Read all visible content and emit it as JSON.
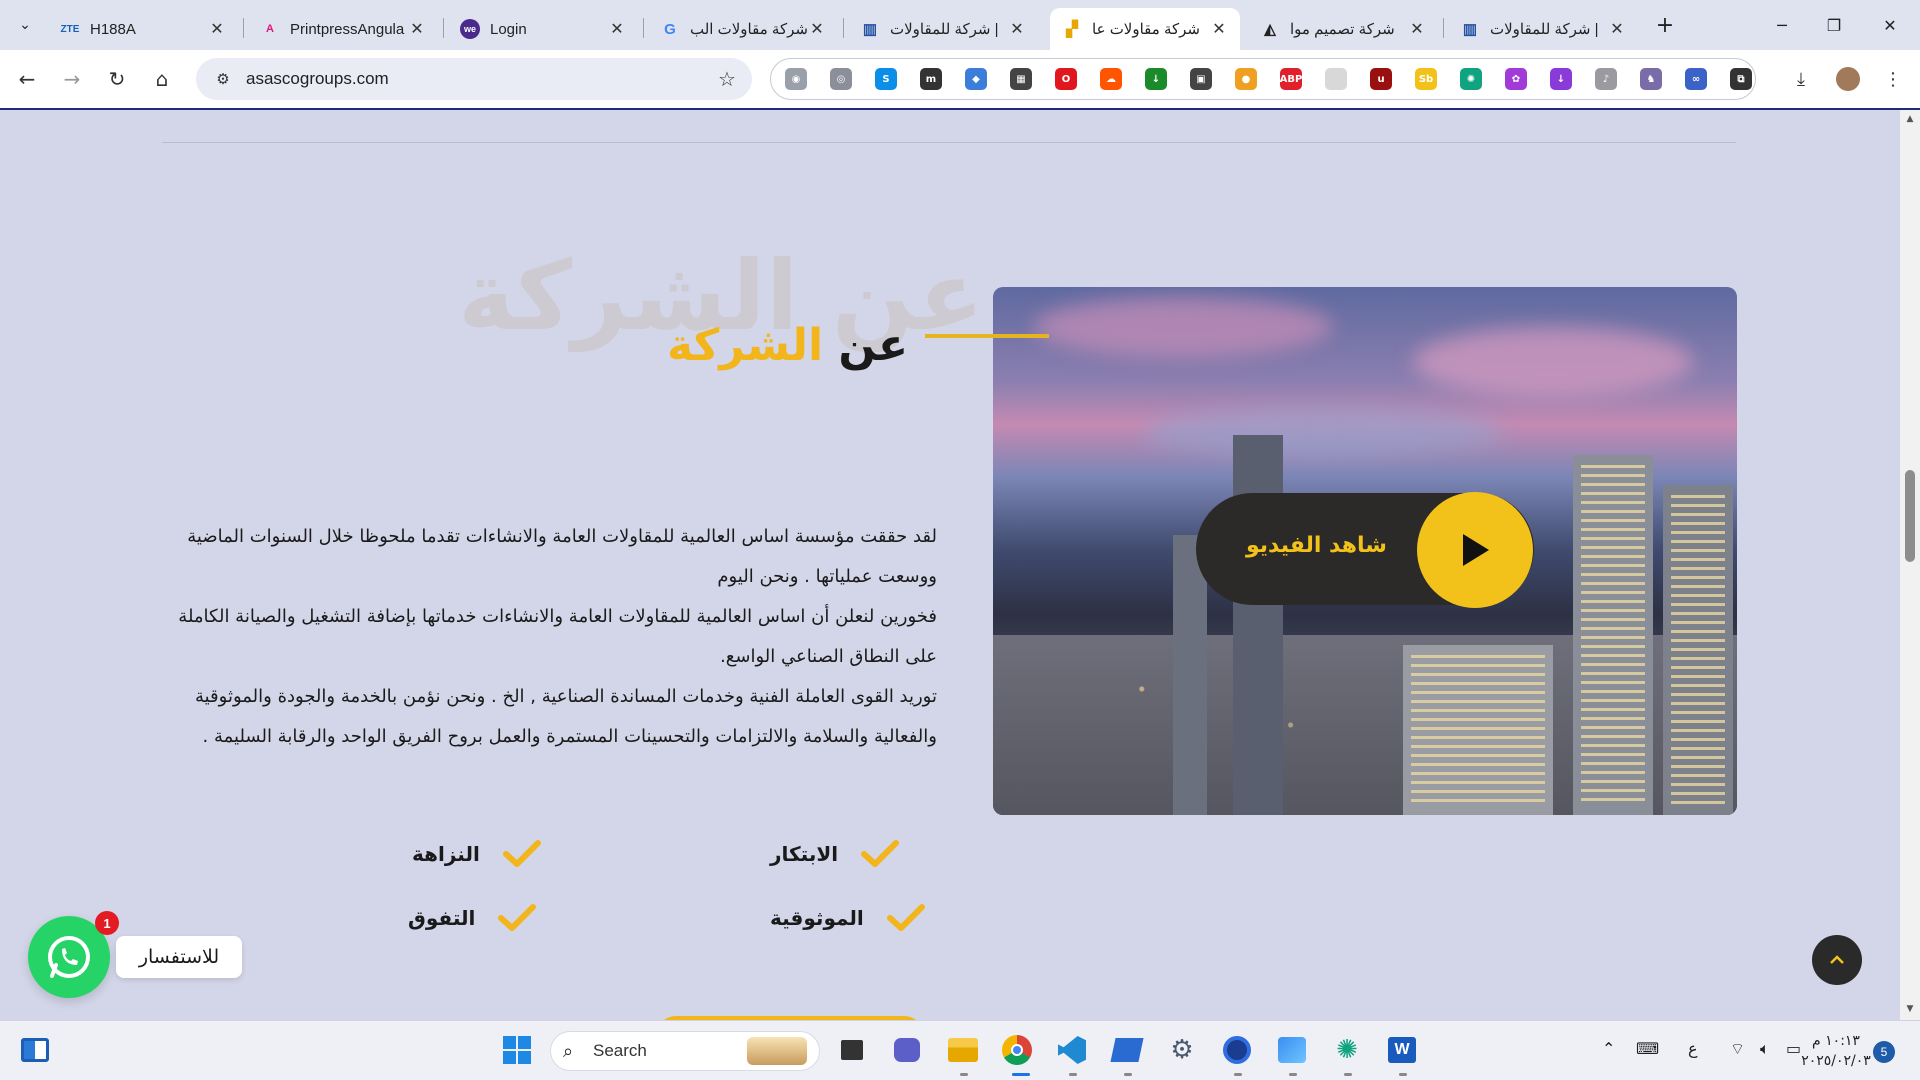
{
  "browser": {
    "tabs": [
      {
        "favicon": "ZTE",
        "title": "H188A",
        "fav_color": "#1762b5",
        "fav_text_color": "#1762b5"
      },
      {
        "favicon": "A",
        "title": "PrintpressAngula",
        "fav_color": "#dd1b7a",
        "fav_text_color": "#dd1b7a"
      },
      {
        "favicon": "we",
        "title": "Login",
        "fav_color": "#4b2a8c",
        "fav_text_color": "#ffffff"
      },
      {
        "favicon": "G",
        "title": "شركة مقاولات الب",
        "fav_color": "#4285f4",
        "fav_text_color": "#4285f4"
      },
      {
        "favicon": "▥",
        "title": "شركة للمقاولات |",
        "fav_color": "#1f4fa0",
        "fav_text_color": "#1f4fa0"
      },
      {
        "favicon": "▞",
        "title": "شركة مقاولات عا",
        "fav_color": "#e6a800",
        "fav_text_color": "#e6a800"
      },
      {
        "favicon": "◭",
        "title": "شركة تصميم موا",
        "fav_color": "#222222",
        "fav_text_color": "#222222"
      },
      {
        "favicon": "▥",
        "title": "شركة للمقاولات |",
        "fav_color": "#1f4fa0",
        "fav_text_color": "#1f4fa0"
      }
    ],
    "active_tab_index": 5,
    "url": "asascogroups.com",
    "extensions": [
      {
        "name": "eye-extension-icon",
        "color": "#9aa0aa",
        "glyph": "◉"
      },
      {
        "name": "target-extension-icon",
        "color": "#8a8f99",
        "glyph": "◎"
      },
      {
        "name": "shazam-extension-icon",
        "color": "#0a8ee8",
        "glyph": "S"
      },
      {
        "name": "m-extension-icon",
        "color": "#333333",
        "glyph": "m"
      },
      {
        "name": "diamond-extension-icon",
        "color": "#3b7dd8",
        "glyph": "◆"
      },
      {
        "name": "qr-extension-icon",
        "color": "#444444",
        "glyph": "▦"
      },
      {
        "name": "opera-extension-icon",
        "color": "#e0171d",
        "glyph": "O"
      },
      {
        "name": "soundcloud-extension-icon",
        "color": "#ff5500",
        "glyph": "☁"
      },
      {
        "name": "download-extension-icon",
        "color": "#1a8a2b",
        "glyph": "↓"
      },
      {
        "name": "box-extension-icon",
        "color": "#444444",
        "glyph": "▣"
      },
      {
        "name": "color-extension-icon",
        "color": "#f0a020",
        "glyph": "●"
      },
      {
        "name": "adblock-extension-icon",
        "color": "#e0202a",
        "glyph": "ABP"
      },
      {
        "name": "blank-extension-icon",
        "color": "#d8d8d8",
        "glyph": " "
      },
      {
        "name": "ublock-extension-icon",
        "color": "#9a0f0f",
        "glyph": "u"
      },
      {
        "name": "sb-extension-icon",
        "color": "#f2c21a",
        "glyph": "Sb"
      },
      {
        "name": "chatgpt-extension-icon",
        "color": "#10a37f",
        "glyph": "✺"
      },
      {
        "name": "brain-extension-icon",
        "color": "#a23ad8",
        "glyph": "✿"
      },
      {
        "name": "purple-down-extension-icon",
        "color": "#8a3ad8",
        "glyph": "↓"
      },
      {
        "name": "music-extension-icon",
        "color": "#9a9aa0",
        "glyph": "♪"
      },
      {
        "name": "bird-extension-icon",
        "color": "#7a6ca8",
        "glyph": "♞"
      },
      {
        "name": "swirl-extension-icon",
        "color": "#3a62c8",
        "glyph": "∞"
      },
      {
        "name": "puzzle-extension-icon",
        "color": "#333333",
        "glyph": "⧉"
      }
    ]
  },
  "about": {
    "watermark": "عن الشركة",
    "heading_main": "عن ",
    "heading_accent": "الشركة",
    "paragraphs": [
      "لقد حققت مؤسسة اساس العالمية للمقاولات العامة والانشاءات تقدما ملحوظا خلال السنوات الماضية ووسعت عملياتها . ونحن اليوم",
      "فخورين لنعلن أن اساس العالمية للمقاولات العامة والانشاءات خدماتها بإضافة التشغيل والصيانة الكاملة على النطاق الصناعي الواسع.",
      "توريد القوى العاملة الفنية وخدمات المساندة الصناعية , الخ . ونحن نؤمن بالخدمة والجودة والموثوقية والفعالية والسلامة والالتزامات والتحسينات المستمرة والعمل بروح الفريق الواحد والرقابة السليمة ."
    ],
    "values": [
      "الابتكار",
      "النزاهة",
      "الموثوقية",
      "التفوق"
    ],
    "video_label": "شاهد الفيديو"
  },
  "whatsapp": {
    "badge": "1",
    "label": "للاستفسار"
  },
  "taskbar": {
    "search_placeholder": "Search",
    "lang": "ع",
    "time": "١٠:١٣ م",
    "date": "٢٠٢٥/٠٢/٠٣",
    "notifications": "5"
  },
  "colors": {
    "accent": "#f2b51c",
    "page_bg": "#d3d6e8",
    "whatsapp": "#25d366"
  }
}
